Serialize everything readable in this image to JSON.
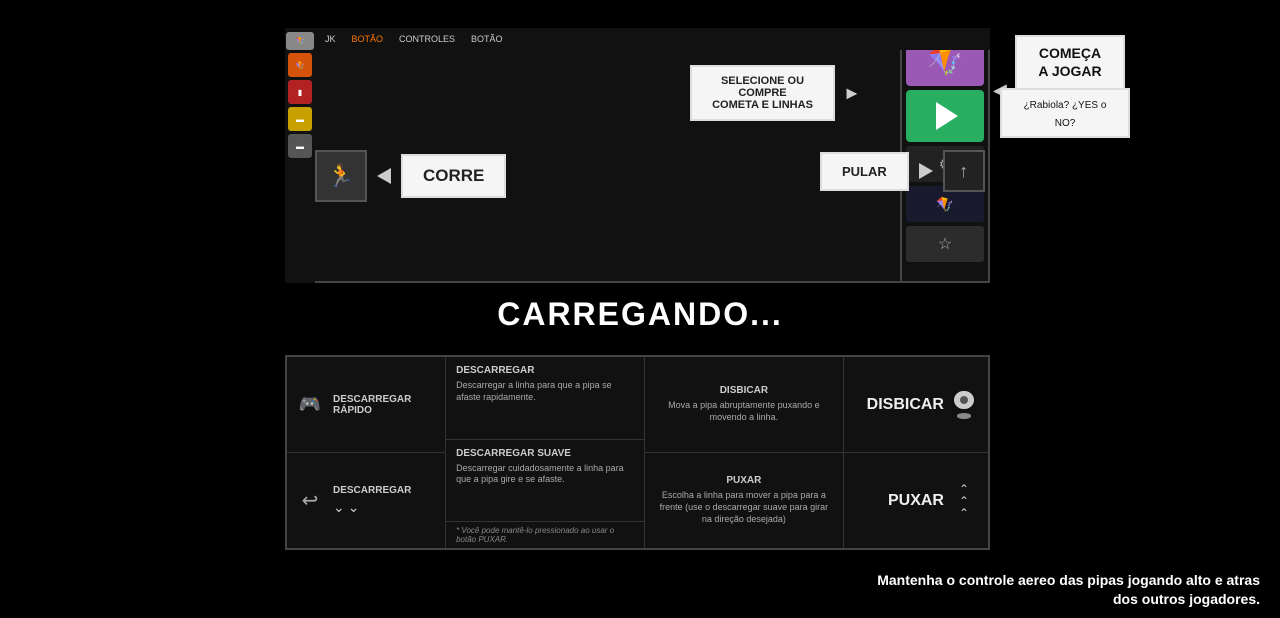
{
  "menu": {
    "items": [
      {
        "label": "JK",
        "active": false
      },
      {
        "label": "BOTÃO",
        "active": false
      },
      {
        "label": "CONTROLES",
        "active": false
      },
      {
        "label": "BOTÃO",
        "active": false
      }
    ]
  },
  "select_box": {
    "label": "SELECIONE OU COMPRE\nCOMETA E LINHAS"
  },
  "comecar": {
    "title": "COMEÇA\nA JOGAR"
  },
  "rabiola": {
    "text": "¿Rabiola? ¿YES o NO?"
  },
  "corre": {
    "label": "CORRE"
  },
  "pular": {
    "label": "PULAR"
  },
  "loading": {
    "text": "CARREGANDO..."
  },
  "instructions": {
    "left_items": [
      {
        "icon": "🎮",
        "label": "DESCARREGAR\nRÁPIDO"
      },
      {
        "icon": "🎮",
        "label": "DESCARREGAR"
      }
    ],
    "middle_items": [
      {
        "title": "DESCARREGAR",
        "desc": "Descarregar a linha para que a pipa se afaste rapidamente."
      },
      {
        "title": "DESCARREGAR SUAVE",
        "desc": "Descarregar cuidadosamente a linha para que a pipa gire e se afaste."
      }
    ],
    "footnote": "* Você pode mantê-lo pressionado ao usar o botão PUXAR.",
    "center_right_items": [
      {
        "title": "DISBICAR",
        "desc": "Mova a pipa abruptamente puxando e movendo a linha."
      },
      {
        "title": "PUXAR",
        "desc": "Escolha a linha para mover a pipa para a frente (use o descarregar suave para girar na direção desejada)"
      }
    ],
    "right_items": [
      {
        "label": "DISBICAR",
        "icon": "scroll"
      },
      {
        "label": "PUXAR",
        "icon": "double-up"
      }
    ]
  },
  "bottom_tip": {
    "line1": "Mantenha o controle aereo das pipas jogando alto e atras",
    "line2": "dos outros jogadores."
  }
}
